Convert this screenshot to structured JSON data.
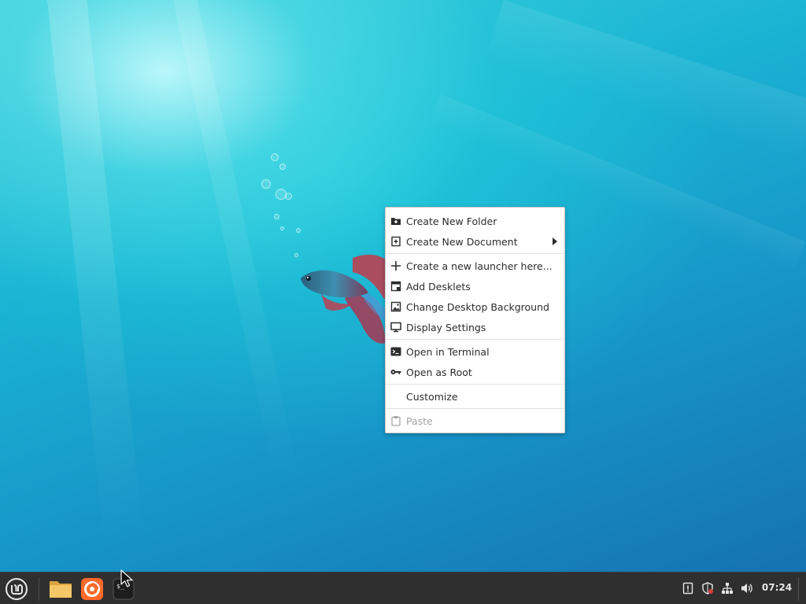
{
  "desktop": {
    "wallpaper": "underwater betta fish",
    "colors": {
      "accent": "#3aa8e0",
      "water_light": "#3cd0dc",
      "water_dark": "#156fae"
    }
  },
  "context_menu": {
    "items": [
      {
        "label": "Create New Folder",
        "icon": "folder-add-icon"
      },
      {
        "label": "Create New Document",
        "icon": "document-add-icon",
        "submenu": true
      },
      {
        "label": "Create a new launcher here...",
        "icon": "plus-icon"
      },
      {
        "label": "Add Desklets",
        "icon": "desklet-icon"
      },
      {
        "label": "Change Desktop Background",
        "icon": "image-icon"
      },
      {
        "label": "Display Settings",
        "icon": "monitor-icon"
      },
      {
        "label": "Open in Terminal",
        "icon": "terminal-icon"
      },
      {
        "label": "Open as Root",
        "icon": "key-icon"
      },
      {
        "label": "Customize",
        "icon": ""
      },
      {
        "label": "Paste",
        "icon": "clipboard-icon",
        "disabled": true
      }
    ]
  },
  "taskbar": {
    "menu_icon": "mint-logo-icon",
    "launchers": [
      {
        "name": "files",
        "icon": "folder-icon"
      },
      {
        "name": "firefox",
        "icon": "firefox-icon",
        "active": true
      },
      {
        "name": "terminal",
        "icon": "terminal-icon"
      }
    ],
    "tray": [
      "notification-icon",
      "shield-icon",
      "network-icon",
      "volume-icon"
    ],
    "clock": "07:24"
  }
}
